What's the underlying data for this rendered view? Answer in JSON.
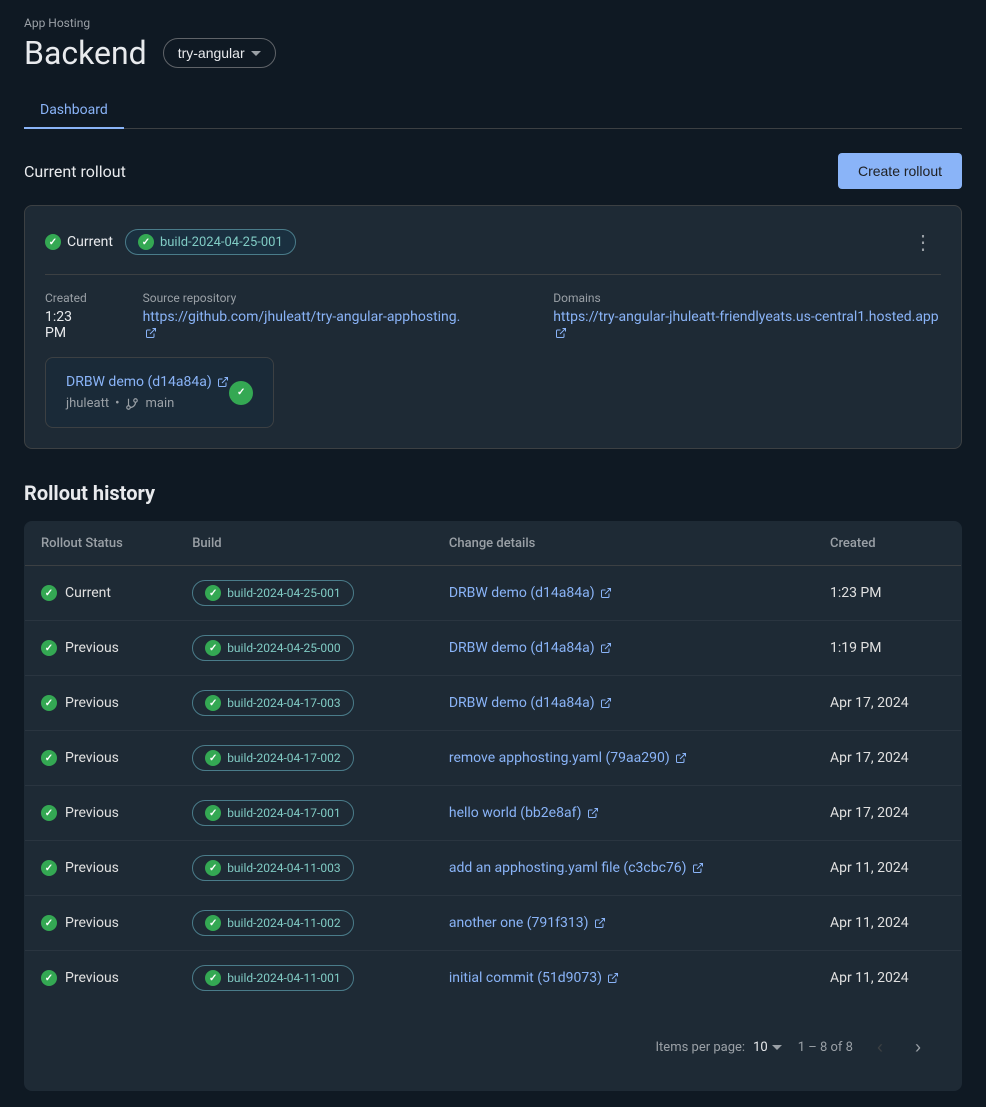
{
  "app": {
    "app_hosting_label": "App Hosting",
    "backend_title": "Backend",
    "branch_selector_value": "try-angular"
  },
  "tabs": [
    {
      "label": "Dashboard",
      "active": true
    }
  ],
  "current_rollout": {
    "section_title": "Current rollout",
    "create_rollout_btn": "Create rollout",
    "status_label": "Current",
    "build_id": "build-2024-04-25-001",
    "created_label": "Created",
    "created_value": "1:23 PM",
    "source_repo_label": "Source repository",
    "source_repo_url": "https://github.com/jhuleatt/try-angular-apphosting",
    "source_repo_display": "https://github.com/jhuleatt/try-angular-apphosting.",
    "domains_label": "Domains",
    "domain_url": "https://try-angular-jhuleatt-friendlyeats.us-central1.hosted.app",
    "domain_display": "https://try-angular-jhuleatt-friendlyeats.us-central1.hosted.app",
    "commit_label": "DRBW demo (d14a84a)",
    "commit_author": "jhuleatt",
    "commit_branch": "main"
  },
  "rollout_history": {
    "title": "Rollout history",
    "columns": {
      "status": "Rollout Status",
      "build": "Build",
      "change": "Change details",
      "created": "Created"
    },
    "rows": [
      {
        "status": "Current",
        "build": "build-2024-04-25-001",
        "change": "DRBW demo (d14a84a)",
        "created": "1:23 PM"
      },
      {
        "status": "Previous",
        "build": "build-2024-04-25-000",
        "change": "DRBW demo (d14a84a)",
        "created": "1:19 PM"
      },
      {
        "status": "Previous",
        "build": "build-2024-04-17-003",
        "change": "DRBW demo (d14a84a)",
        "created": "Apr 17, 2024"
      },
      {
        "status": "Previous",
        "build": "build-2024-04-17-002",
        "change": "remove apphosting.yaml (79aa290)",
        "created": "Apr 17, 2024"
      },
      {
        "status": "Previous",
        "build": "build-2024-04-17-001",
        "change": "hello world (bb2e8af)",
        "created": "Apr 17, 2024"
      },
      {
        "status": "Previous",
        "build": "build-2024-04-11-003",
        "change": "add an apphosting.yaml file (c3cbc76)",
        "created": "Apr 11, 2024"
      },
      {
        "status": "Previous",
        "build": "build-2024-04-11-002",
        "change": "another one (791f313)",
        "created": "Apr 11, 2024"
      },
      {
        "status": "Previous",
        "build": "build-2024-04-11-001",
        "change": "initial commit (51d9073)",
        "created": "Apr 11, 2024"
      }
    ],
    "pagination": {
      "items_per_page_label": "Items per page:",
      "items_per_page_value": "10",
      "range_label": "1 – 8 of 8"
    }
  }
}
